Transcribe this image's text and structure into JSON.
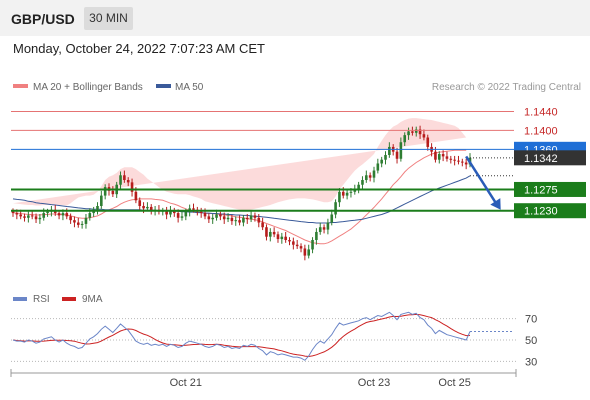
{
  "header": {
    "symbol": "GBP/USD",
    "interval": "30 MIN"
  },
  "datetime": "Monday, October 24, 2022 7:07:23 AM CET",
  "colors": {
    "up": "#2e7d32",
    "down": "#b71c1c",
    "band_fill": "#fbd5d5",
    "ma20": "#f08080",
    "ma50": "#3a5a9a",
    "resistance": "#e57373",
    "support": "#1b7d1b",
    "rsi": "#6b86c8",
    "rsi_ma": "#cc2222",
    "pivot_label": "#1f6fd6",
    "current_label": "#333333",
    "arrow": "#2a5cb8"
  },
  "chart_data": [
    {
      "type": "candlestick",
      "legend": [
        {
          "label": "MA 20 + Bollinger Bands",
          "color": "#f08080"
        },
        {
          "label": "MA 50",
          "color": "#3a5a9a"
        }
      ],
      "copyright": "Research © 2022 Trading Central",
      "ylim": [
        1.106,
        1.1475
      ],
      "levels": [
        {
          "value": 1.144,
          "label": "1.1440",
          "kind": "resistance"
        },
        {
          "value": 1.14,
          "label": "1.1400",
          "kind": "resistance"
        },
        {
          "value": 1.136,
          "label": "1.1360",
          "kind": "pivot"
        },
        {
          "value": 1.1342,
          "label": "1.1342",
          "kind": "current"
        },
        {
          "value": 1.1275,
          "label": "1.1275",
          "kind": "support"
        },
        {
          "value": 1.123,
          "label": "1.1230",
          "kind": "support"
        }
      ],
      "x_ticks": [
        {
          "index": 45,
          "label": "Oct 21"
        },
        {
          "index": 94,
          "label": "Oct 23"
        },
        {
          "index": 115,
          "label": "Oct 25"
        }
      ],
      "close": [
        1.1225,
        1.1222,
        1.1218,
        1.1215,
        1.122,
        1.1218,
        1.1212,
        1.1215,
        1.1225,
        1.1228,
        1.1232,
        1.1225,
        1.122,
        1.1225,
        1.1218,
        1.121,
        1.1205,
        1.12,
        1.1202,
        1.1215,
        1.1225,
        1.1232,
        1.124,
        1.1262,
        1.128,
        1.1272,
        1.1265,
        1.1285,
        1.1305,
        1.1295,
        1.129,
        1.127,
        1.1252,
        1.124,
        1.1235,
        1.1238,
        1.123,
        1.1232,
        1.1228,
        1.123,
        1.1222,
        1.123,
        1.1225,
        1.1215,
        1.1218,
        1.1228,
        1.1235,
        1.1232,
        1.1228,
        1.1225,
        1.1218,
        1.1212,
        1.1215,
        1.1222,
        1.1218,
        1.1212,
        1.1215,
        1.1208,
        1.121,
        1.1205,
        1.1215,
        1.1212,
        1.122,
        1.1215,
        1.1205,
        1.1195,
        1.1175,
        1.1185,
        1.118,
        1.117,
        1.1175,
        1.1168,
        1.1165,
        1.1158,
        1.1155,
        1.115,
        1.1135,
        1.1148,
        1.1168,
        1.1185,
        1.1195,
        1.119,
        1.1205,
        1.1222,
        1.1248,
        1.127,
        1.1262,
        1.1268,
        1.127,
        1.1275,
        1.1285,
        1.1295,
        1.1305,
        1.13,
        1.1315,
        1.133,
        1.1338,
        1.1348,
        1.1365,
        1.1355,
        1.134,
        1.1375,
        1.139,
        1.1398,
        1.1395,
        1.1402,
        1.1392,
        1.1385,
        1.1365,
        1.1355,
        1.1338,
        1.135,
        1.1345,
        1.134,
        1.1338,
        1.1336,
        1.1334,
        1.1332,
        1.1328,
        1.1342
      ],
      "bollinger": {
        "ma20": [
          1.1226,
          1.1225,
          1.1224,
          1.1223,
          1.1222,
          1.1222,
          1.1221,
          1.1221,
          1.1222,
          1.1222,
          1.1223,
          1.1223,
          1.1222,
          1.1222,
          1.1221,
          1.1219,
          1.1217,
          1.1215,
          1.1214,
          1.1214,
          1.1215,
          1.1217,
          1.1219,
          1.1223,
          1.1228,
          1.1232,
          1.1235,
          1.1239,
          1.1244,
          1.1248,
          1.1251,
          1.1253,
          1.1254,
          1.1255,
          1.1255,
          1.1255,
          1.1255,
          1.1254,
          1.1253,
          1.1252,
          1.1249,
          1.1246,
          1.1244,
          1.1241,
          1.1237,
          1.1234,
          1.123,
          1.1228,
          1.1227,
          1.1226,
          1.1225,
          1.1224,
          1.1224,
          1.1223,
          1.1222,
          1.1221,
          1.122,
          1.1219,
          1.1217,
          1.1216,
          1.1215,
          1.1213,
          1.1212,
          1.1211,
          1.1209,
          1.1206,
          1.1203,
          1.12,
          1.1197,
          1.1194,
          1.1191,
          1.1188,
          1.1184,
          1.118,
          1.1176,
          1.1172,
          1.1168,
          1.1165,
          1.1162,
          1.1161,
          1.116,
          1.116,
          1.1162,
          1.1166,
          1.1171,
          1.1176,
          1.1181,
          1.1186,
          1.1191,
          1.1198,
          1.1205,
          1.1213,
          1.1221,
          1.1229,
          1.1237,
          1.1246,
          1.1255,
          1.1265,
          1.1275,
          1.1285,
          1.1293,
          1.1302,
          1.1312,
          1.132,
          1.1326,
          1.1332,
          1.1337,
          1.1342,
          1.1346,
          1.135,
          1.1352,
          1.1354,
          1.1355,
          1.1356,
          1.1357,
          1.1358,
          1.1358,
          1.1358,
          1.1358
        ],
        "upper": [
          1.1246,
          1.1245,
          1.1244,
          1.1243,
          1.1242,
          1.1242,
          1.1241,
          1.1241,
          1.1242,
          1.1242,
          1.1243,
          1.1243,
          1.1242,
          1.1242,
          1.1241,
          1.1246,
          1.1252,
          1.1258,
          1.126,
          1.1262,
          1.1262,
          1.1264,
          1.127,
          1.1282,
          1.1295,
          1.1302,
          1.1305,
          1.131,
          1.1318,
          1.1322,
          1.1322,
          1.1322,
          1.1318,
          1.1312,
          1.1306,
          1.1298,
          1.1292,
          1.1286,
          1.128,
          1.1274,
          1.127,
          1.1268,
          1.1266,
          1.1265,
          1.1265,
          1.1265,
          1.1263,
          1.126,
          1.1258,
          1.1255,
          1.125,
          1.1248,
          1.1246,
          1.1244,
          1.1242,
          1.124,
          1.1238,
          1.1236,
          1.1234,
          1.1232,
          1.1231,
          1.123,
          1.1232,
          1.1234,
          1.1236,
          1.1238,
          1.124,
          1.1242,
          1.1245,
          1.1248,
          1.125,
          1.1252,
          1.1254,
          1.1255,
          1.1256,
          1.1256,
          1.1256,
          1.1255,
          1.1254,
          1.1252,
          1.125,
          1.1248,
          1.1248,
          1.125,
          1.126,
          1.1275,
          1.1285,
          1.1295,
          1.1305,
          1.1315,
          1.1322,
          1.1328,
          1.1335,
          1.1342,
          1.135,
          1.1365,
          1.1378,
          1.139,
          1.14,
          1.1408,
          1.1412,
          1.1418,
          1.1422,
          1.1425,
          1.1426,
          1.1426,
          1.1425,
          1.1424,
          1.1423,
          1.1422,
          1.142,
          1.1418,
          1.1416,
          1.1414,
          1.1412,
          1.141,
          1.1405,
          1.1395,
          1.1385
        ],
        "lower": [
          1.1206,
          1.1205,
          1.1204,
          1.1203,
          1.1202,
          1.1202,
          1.1201,
          1.1201,
          1.1202,
          1.1202,
          1.1203,
          1.1203,
          1.1202,
          1.1202,
          1.1201,
          1.1192,
          1.1182,
          1.1172,
          1.1168,
          1.1166,
          1.1168,
          1.117,
          1.1168,
          1.1164,
          1.1161,
          1.1162,
          1.1165,
          1.1168,
          1.117,
          1.1174,
          1.118,
          1.1184,
          1.119,
          1.1198,
          1.1204,
          1.1212,
          1.1218,
          1.1222,
          1.1226,
          1.123,
          1.1228,
          1.1224,
          1.1222,
          1.1217,
          1.1209,
          1.1203,
          1.1197,
          1.1196,
          1.1196,
          1.1197,
          1.12,
          1.12,
          1.1202,
          1.1202,
          1.1202,
          1.1202,
          1.1202,
          1.1202,
          1.12,
          1.12,
          1.1199,
          1.1196,
          1.1192,
          1.1188,
          1.1182,
          1.1174,
          1.1166,
          1.1158,
          1.1149,
          1.114,
          1.1132,
          1.1124,
          1.1114,
          1.1105,
          1.1096,
          1.1088,
          1.108,
          1.1075,
          1.107,
          1.107,
          1.107,
          1.1072,
          1.1076,
          1.1082,
          1.1082,
          1.1077,
          1.1077,
          1.1077,
          1.1077,
          1.1081,
          1.1088,
          1.1098,
          1.1107,
          1.1116,
          1.1124,
          1.1127,
          1.1132,
          1.114,
          1.115,
          1.1162,
          1.1174,
          1.1186,
          1.1202,
          1.1215,
          1.1226,
          1.1238,
          1.1249,
          1.126,
          1.1269,
          1.1278,
          1.1284,
          1.129,
          1.1294,
          1.1298,
          1.1302,
          1.1306,
          1.1311,
          1.1321,
          1.1331
        ]
      },
      "ma50": [
        1.1255,
        1.1254,
        1.1253,
        1.1252,
        1.125,
        1.1249,
        1.1247,
        1.1246,
        1.1245,
        1.1244,
        1.1243,
        1.1242,
        1.1241,
        1.124,
        1.1239,
        1.1238,
        1.1237,
        1.1236,
        1.1235,
        1.1234,
        1.1234,
        1.1233,
        1.1233,
        1.1233,
        1.1232,
        1.1232,
        1.1232,
        1.1232,
        1.1232,
        1.1232,
        1.1232,
        1.1232,
        1.1232,
        1.1232,
        1.1231,
        1.1231,
        1.1231,
        1.1231,
        1.123,
        1.123,
        1.123,
        1.1229,
        1.1229,
        1.1229,
        1.1228,
        1.1228,
        1.1227,
        1.1227,
        1.1226,
        1.1226,
        1.1225,
        1.1225,
        1.1224,
        1.1224,
        1.1223,
        1.1223,
        1.1222,
        1.1222,
        1.1221,
        1.1221,
        1.122,
        1.122,
        1.1219,
        1.1218,
        1.1218,
        1.1217,
        1.1216,
        1.1215,
        1.1214,
        1.1213,
        1.1212,
        1.1211,
        1.121,
        1.1209,
        1.1208,
        1.1207,
        1.1206,
        1.1205,
        1.1205,
        1.1204,
        1.1204,
        1.1204,
        1.1204,
        1.1205,
        1.1205,
        1.1206,
        1.1207,
        1.1208,
        1.1209,
        1.121,
        1.1211,
        1.1212,
        1.1214,
        1.1216,
        1.1218,
        1.122,
        1.1222,
        1.1225,
        1.1228,
        1.1232,
        1.1236,
        1.124,
        1.1244,
        1.1248,
        1.1252,
        1.1256,
        1.126,
        1.1264,
        1.1268,
        1.1272,
        1.1275,
        1.1278,
        1.1281,
        1.1284,
        1.1287,
        1.129,
        1.1293,
        1.1296,
        1.1299,
        1.1304
      ],
      "projection": {
        "from_index": 118,
        "to_index": 127,
        "from_value": 1.1345,
        "to_value": 1.1232
      }
    },
    {
      "type": "line",
      "legend": [
        {
          "label": "RSI",
          "color": "#6b86c8"
        },
        {
          "label": "9MA",
          "color": "#cc2222"
        }
      ],
      "ylim": [
        20,
        80
      ],
      "yticks": [
        70,
        50,
        30
      ],
      "rsi": [
        50,
        49,
        49,
        48,
        50,
        49,
        47,
        48,
        51,
        52,
        53,
        50,
        48,
        50,
        47,
        45,
        44,
        42,
        43,
        47,
        51,
        53,
        56,
        60,
        63,
        60,
        57,
        61,
        65,
        62,
        59,
        54,
        49,
        47,
        46,
        47,
        45,
        46,
        45,
        46,
        44,
        46,
        45,
        43,
        44,
        47,
        49,
        48,
        47,
        46,
        44,
        43,
        44,
        46,
        45,
        43,
        44,
        42,
        43,
        42,
        45,
        44,
        46,
        45,
        42,
        40,
        36,
        39,
        38,
        36,
        37,
        36,
        35,
        34,
        34,
        33,
        31,
        35,
        41,
        46,
        49,
        47,
        51,
        55,
        61,
        66,
        64,
        65,
        66,
        67,
        68,
        70,
        71,
        69,
        71,
        73,
        72,
        74,
        76,
        73,
        69,
        74,
        75,
        76,
        74,
        75,
        71,
        69,
        64,
        61,
        56,
        59,
        57,
        55,
        54,
        53,
        52,
        51,
        50,
        58
      ]
    }
  ]
}
